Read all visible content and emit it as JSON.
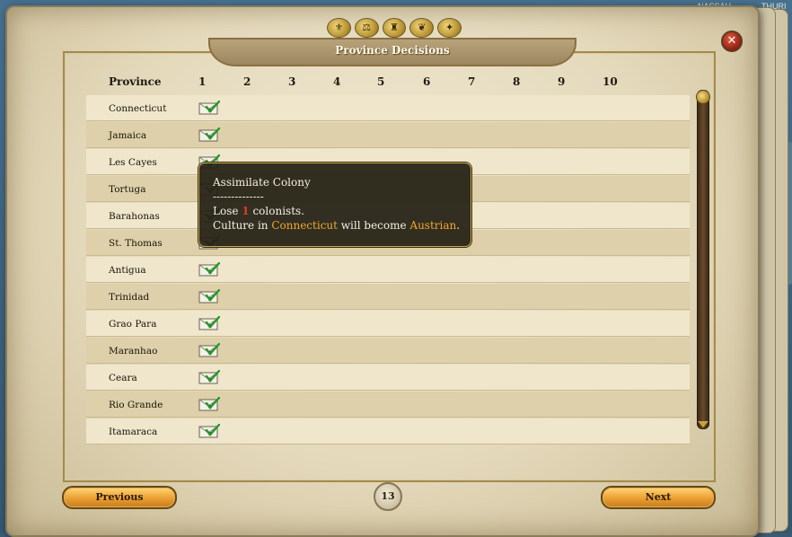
{
  "background": {
    "map_labels": [
      "NASSAU",
      "THURI"
    ]
  },
  "header": {
    "title": "Province Decisions",
    "icons": [
      "mint-icon",
      "trade-icon",
      "army-icon",
      "food-icon",
      "wealth-icon"
    ]
  },
  "table": {
    "column_province": "Province",
    "columns": [
      "1",
      "2",
      "3",
      "4",
      "5",
      "6",
      "7",
      "8",
      "9",
      "10"
    ],
    "rows": [
      {
        "province": "Connecticut"
      },
      {
        "province": "Jamaica"
      },
      {
        "province": "Les Cayes"
      },
      {
        "province": "Tortuga"
      },
      {
        "province": "Barahonas"
      },
      {
        "province": "St. Thomas"
      },
      {
        "province": "Antigua"
      },
      {
        "province": "Trinidad"
      },
      {
        "province": "Grao Para"
      },
      {
        "province": "Maranhao"
      },
      {
        "province": "Ceara"
      },
      {
        "province": "Rio Grande"
      },
      {
        "province": "Itamaraca"
      }
    ]
  },
  "tooltip": {
    "title": "Assimilate Colony",
    "separator": "--------------",
    "lose_prefix": "Lose ",
    "lose_value": "1",
    "lose_suffix": " colonists.",
    "culture_prefix": "Culture in ",
    "province": "Connecticut",
    "culture_mid": " will become ",
    "culture": "Austrian",
    "culture_suffix": "."
  },
  "footer": {
    "previous_label": "Previous",
    "next_label": "Next",
    "page_number": "13"
  },
  "colors": {
    "highlight_red": "#e23a24",
    "highlight_orange": "#f2a62c",
    "button_gold": "#f0a83a"
  }
}
